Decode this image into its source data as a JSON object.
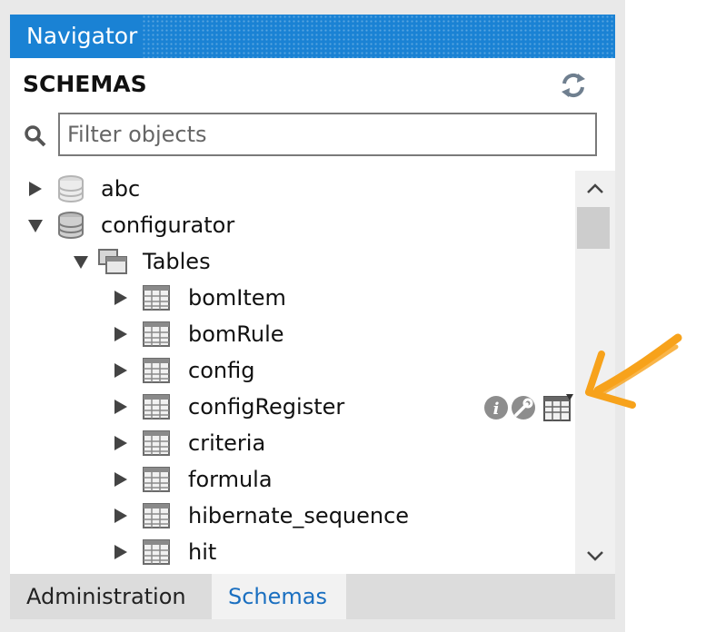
{
  "navigator": {
    "title": "Navigator"
  },
  "schemas": {
    "title": "SCHEMAS",
    "refresh_icon": "refresh-icon",
    "filter": {
      "placeholder": "Filter objects",
      "value": ""
    }
  },
  "tree": {
    "schema_abc": {
      "label": "abc",
      "expanded": false
    },
    "schema_configurator": {
      "label": "configurator",
      "expanded": true
    },
    "tables_folder": {
      "label": "Tables",
      "expanded": true
    },
    "tables": [
      {
        "label": "bomItem"
      },
      {
        "label": "bomRule"
      },
      {
        "label": "config"
      },
      {
        "label": "configRegister",
        "hovered": true
      },
      {
        "label": "criteria"
      },
      {
        "label": "formula"
      },
      {
        "label": "hibernate_sequence"
      },
      {
        "label": "hit"
      }
    ]
  },
  "hover_actions": [
    "info-icon",
    "wrench-icon",
    "table-data-icon"
  ],
  "tabs": [
    {
      "label": "Administration",
      "active": false
    },
    {
      "label": "Schemas",
      "active": true
    }
  ],
  "colors": {
    "header": "#1a82d4",
    "annotation_arrow": "#f7a21b",
    "active_tab_text": "#1a6fc0"
  }
}
